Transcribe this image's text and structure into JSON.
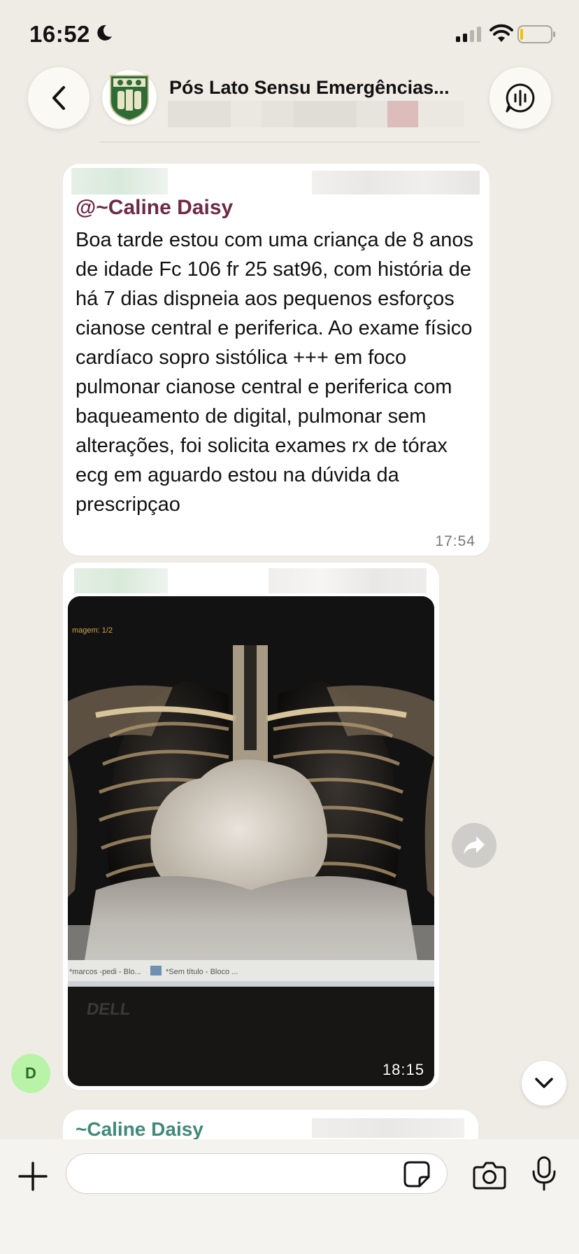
{
  "status_bar": {
    "time": "16:52",
    "icons": [
      "moon-icon",
      "signal-icon",
      "wifi-icon",
      "battery-icon"
    ]
  },
  "header": {
    "group_name": "Pós Lato Sensu Emergências...",
    "icons": [
      "chevron-left-icon",
      "group-logo-icon",
      "voice-chat-icon"
    ]
  },
  "messages": [
    {
      "type": "text",
      "reply_mention": "@~Caline Daisy",
      "body": "Boa tarde estou com uma criança de 8 anos de idade Fc 106 fr 25 sat96, com história de há 7 dias dispneia aos pequenos esforços cianose central e periferica. Ao exame físico cardíaco sopro sistólica +++ em foco pulmonar cianose central e periferica com baqueamento de digital, pulmonar sem alterações, foi solicita exames rx de tórax ecg em aguardo estou na dúvida da prescripçao",
      "time": "17:54"
    },
    {
      "type": "image",
      "image_text": {
        "top_label": "magem: 1/2",
        "taskbar_item_1": "*marcos -pedi - Blo...",
        "taskbar_item_2": "*Sem título - Bloco ...",
        "monitor_brand": "DELL"
      },
      "time": "18:15"
    },
    {
      "type": "text",
      "author": "~Caline Daisy"
    }
  ],
  "sender_avatar_initial": "D",
  "composer": {
    "input_value": "",
    "input_placeholder": "",
    "icons": [
      "plus-icon",
      "sticker-icon",
      "camera-icon",
      "microphone-icon"
    ]
  },
  "colors": {
    "background": "#efece6",
    "mention": "#6e2a45",
    "author": "#3f8a7a",
    "avatar": "#b9f3a8"
  }
}
